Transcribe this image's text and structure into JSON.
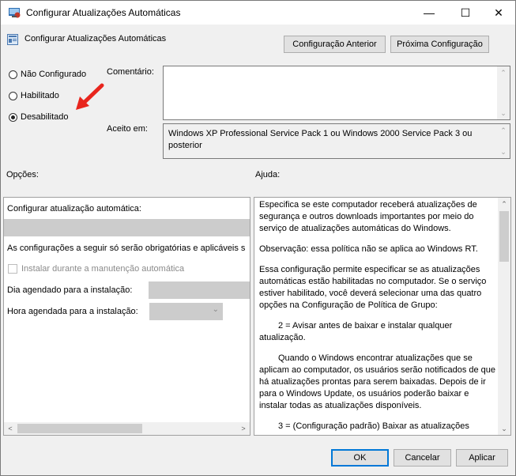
{
  "window": {
    "title": "Configurar Atualizações Automáticas",
    "minimize_glyph": "—",
    "maximize_glyph": "☐",
    "close_glyph": "✕"
  },
  "header": {
    "setting_title": "Configurar Atualizações Automáticas",
    "prev_button": "Configuração Anterior",
    "next_button": "Próxima Configuração"
  },
  "state": {
    "options": [
      "Não Configurado",
      "Habilitado",
      "Desabilitado"
    ],
    "selected": "Desabilitado"
  },
  "comment": {
    "label": "Comentário:",
    "value": ""
  },
  "supported": {
    "label": "Aceito em:",
    "value": "Windows XP Professional Service Pack 1 ou Windows 2000 Service Pack 3 ou posterior"
  },
  "options_panel": {
    "label": "Opções:",
    "configure_label": "Configurar atualização automática:",
    "info_text": "As configurações a seguir só serão obrigatórias e aplicáveis s",
    "install_maintenance": "Instalar durante a manutenção automática",
    "scheduled_day_label": "Dia agendado para a instalação:",
    "scheduled_time_label": "Hora agendada para a instalação:"
  },
  "help_panel": {
    "label": "Ajuda:",
    "paragraphs": [
      "Especifica se este computador receberá atualizações de segurança e outros downloads importantes por meio do serviço de atualizações automáticas do Windows.",
      "Observação: essa política não se aplica ao Windows RT.",
      "Essa configuração permite especificar se as atualizações automáticas estão habilitadas no computador. Se o serviço estiver habilitado, você deverá selecionar uma das quatro opções na Configuração de Política de Grupo:",
      "2 = Avisar antes de baixar e instalar qualquer atualização.",
      "Quando o Windows encontrar atualizações que se aplicam ao computador, os usuários serão notificados de que há atualizações prontas para serem baixadas. Depois de ir para o Windows Update, os usuários poderão baixar e instalar todas as atualizações disponíveis.",
      "3 = (Configuração padrão) Baixar as atualizações"
    ]
  },
  "footer": {
    "ok": "OK",
    "cancel": "Cancelar",
    "apply": "Aplicar"
  },
  "annotation": {
    "arrow_color": "#e8251d"
  }
}
